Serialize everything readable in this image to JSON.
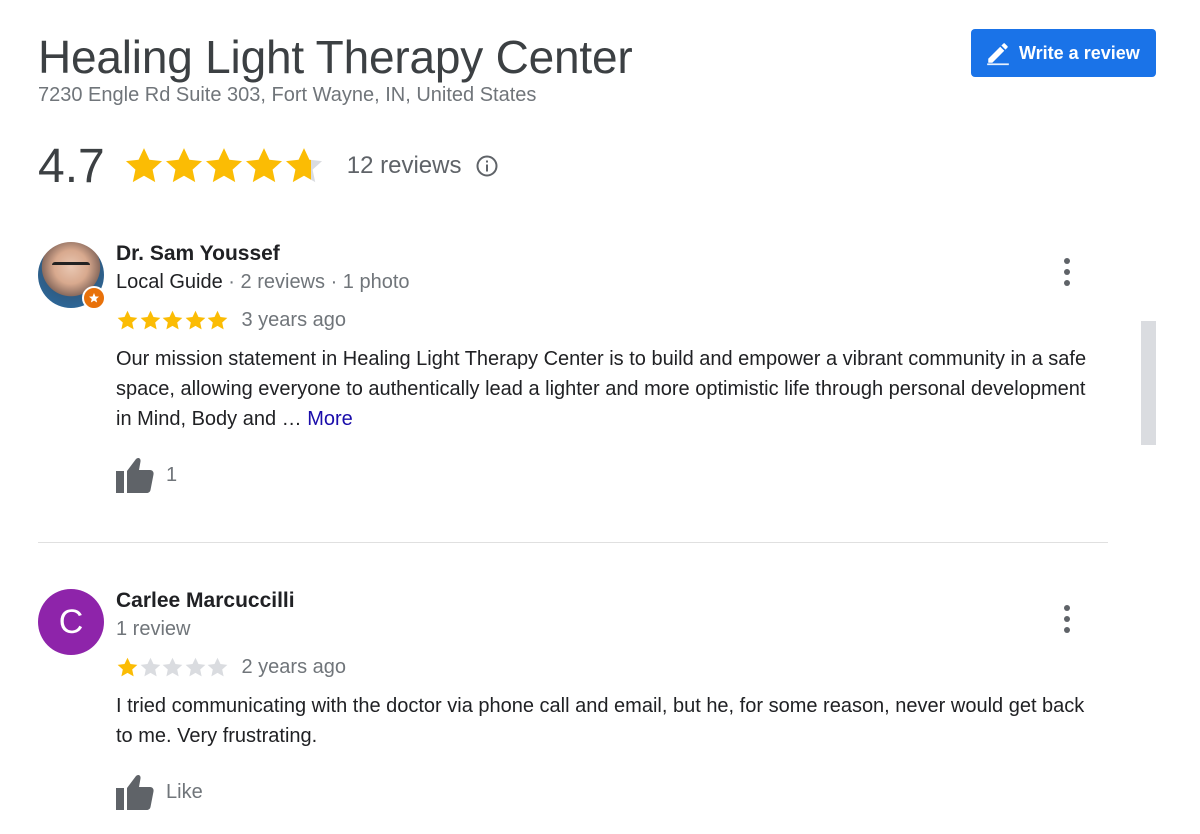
{
  "place": {
    "name": "Healing Light Therapy Center",
    "address": "7230 Engle Rd Suite 303, Fort Wayne, IN, United States"
  },
  "write_review": {
    "label": "Write a review",
    "icon": "pencil-icon"
  },
  "summary": {
    "rating": "4.7",
    "stars_filled": 4.7,
    "reviews_label": "12 reviews",
    "info_icon": "info-icon"
  },
  "colors": {
    "star_filled": "#fbbc04",
    "star_empty": "#dadce0",
    "button": "#1a73e8",
    "link": "#1a0dab",
    "badge": "#e8710a",
    "letter_avatar": "#8e24aa"
  },
  "reviews": [
    {
      "name": "Dr. Sam Youssef",
      "meta_badge": "Local Guide",
      "meta_sep1": " · ",
      "meta_reviews": "2 reviews",
      "meta_sep2": " · ",
      "meta_photos": "1 photo",
      "stars": 5,
      "date": "3 years ago",
      "text": "Our mission statement in Healing Light Therapy Center is to build and empower a vibrant community in a safe space, allowing everyone to authentically lead a lighter and more optimistic life through personal development in Mind, Body and … ",
      "more": "More",
      "like_label": "1"
    },
    {
      "name": "Carlee Marcuccilli",
      "avatar_letter": "C",
      "meta_reviews": "1 review",
      "stars": 1,
      "date": "2 years ago",
      "text": "I tried communicating with the doctor via phone call and email, but he, for some reason, never would get back to me. Very frustrating.",
      "like_label": "Like"
    }
  ]
}
